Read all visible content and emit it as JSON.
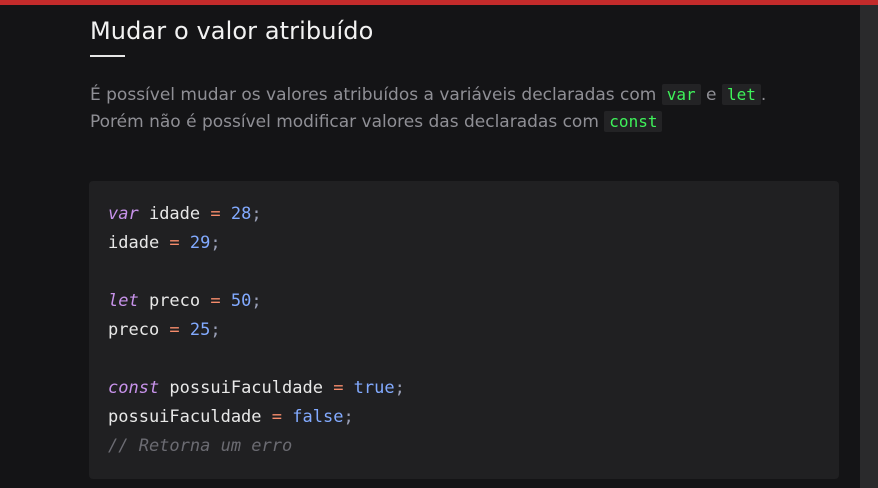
{
  "section": {
    "title": "Mudar o valor atribuído",
    "paragraph": {
      "part1": "É possível mudar os valores atribuídos a variáveis declaradas com ",
      "code1": "var",
      "part2": " e ",
      "code2": "let",
      "part3": ". Porém não é possível modificar valores das declaradas com ",
      "code3": "const"
    }
  },
  "code": {
    "line1": {
      "kw": "var",
      "ident": " idade ",
      "op": "=",
      "value": " 28",
      "end": ";"
    },
    "line2": {
      "ident": "idade ",
      "op": "=",
      "value": " 29",
      "end": ";"
    },
    "line3": {
      "kw": "let",
      "ident": " preco ",
      "op": "=",
      "value": " 50",
      "end": ";"
    },
    "line4": {
      "ident": "preco ",
      "op": "=",
      "value": " 25",
      "end": ";"
    },
    "line5": {
      "kw": "const",
      "ident": " possuiFaculdade ",
      "op": "=",
      "value": " true",
      "end": ";"
    },
    "line6": {
      "ident": "possuiFaculdade ",
      "op": "=",
      "value": " false",
      "end": ";"
    },
    "line7": {
      "comment": "// Retorna um erro"
    }
  },
  "colors": {
    "topbar": "#c42b2b",
    "inline_code_text": "#3ef25a",
    "keyword": "#c792ea",
    "operator": "#f78c6c",
    "number": "#82aaff",
    "comment": "#6b6b72"
  }
}
